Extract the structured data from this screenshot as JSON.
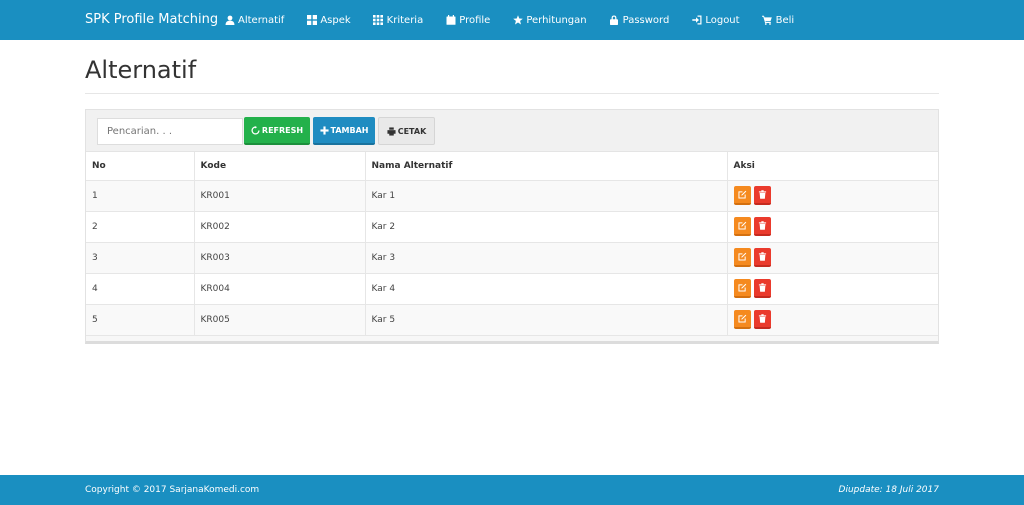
{
  "navbar": {
    "brand": "SPK Profile Matching",
    "items": [
      {
        "label": "Alternatif",
        "icon": "user-icon"
      },
      {
        "label": "Aspek",
        "icon": "grid-large-icon"
      },
      {
        "label": "Kriteria",
        "icon": "grid-small-icon"
      },
      {
        "label": "Profile",
        "icon": "calendar-icon"
      },
      {
        "label": "Perhitungan",
        "icon": "star-icon"
      },
      {
        "label": "Password",
        "icon": "lock-icon"
      },
      {
        "label": "Logout",
        "icon": "logout-icon"
      },
      {
        "label": "Beli",
        "icon": "cart-icon"
      }
    ]
  },
  "page": {
    "title": "Alternatif"
  },
  "toolbar": {
    "search_placeholder": "Pencarian. . .",
    "refresh_label": "REFRESH",
    "add_label": "TAMBAH",
    "print_label": "CETAK"
  },
  "table": {
    "headers": [
      "No",
      "Kode",
      "Nama Alternatif",
      "Aksi"
    ],
    "rows": [
      {
        "no": "1",
        "kode": "KR001",
        "nama": "Kar 1"
      },
      {
        "no": "2",
        "kode": "KR002",
        "nama": "Kar 2"
      },
      {
        "no": "3",
        "kode": "KR003",
        "nama": "Kar 3"
      },
      {
        "no": "4",
        "kode": "KR004",
        "nama": "Kar 4"
      },
      {
        "no": "5",
        "kode": "KR005",
        "nama": "Kar 5"
      }
    ]
  },
  "footer": {
    "copyright": "Copyright © 2017 SarjanaKomedi.com",
    "updated": "Diupdate: 18 Juli 2017"
  },
  "colors": {
    "primary": "#1a8fc1",
    "refresh": "#23b14b",
    "edit": "#f58a1f",
    "delete": "#ea3a2c"
  }
}
